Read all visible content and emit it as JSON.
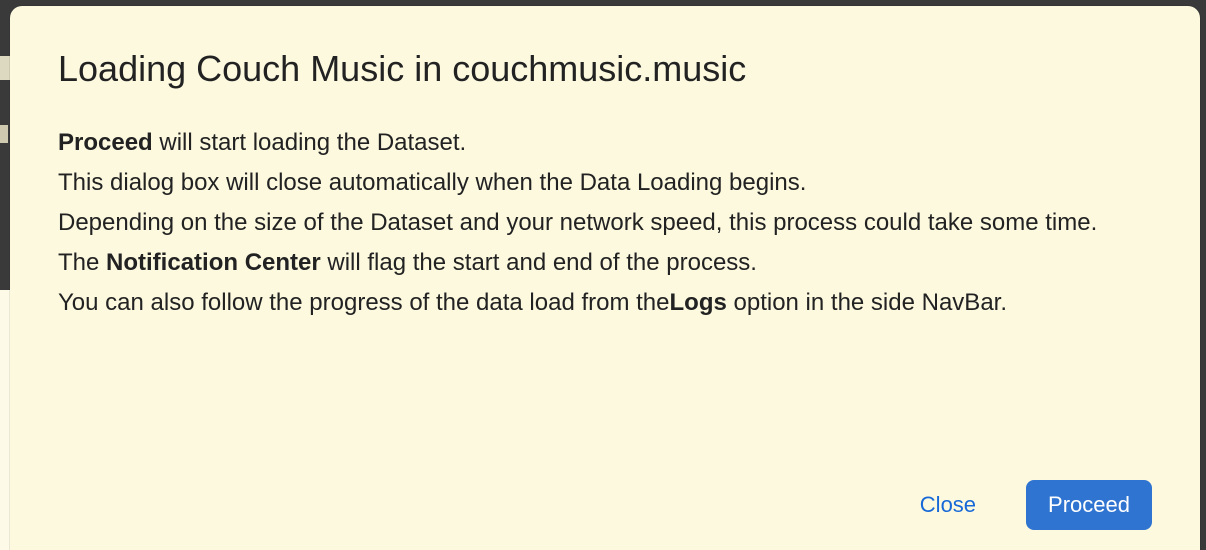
{
  "modal": {
    "title": "Loading Couch Music in couchmusic.music",
    "body": {
      "line1_strong": "Proceed",
      "line1_rest": " will start loading the Dataset.",
      "line2": "This dialog box will close automatically when the Data Loading begins.",
      "line3": "Depending on the size of the Dataset and your network speed, this process could take some time.",
      "line4_pre": "The ",
      "line4_strong": "Notification Center",
      "line4_post": " will flag the start and end of the process.",
      "line5_pre": "You can also follow the progress of the data load from the",
      "line5_strong": "Logs",
      "line5_post": " option in the side NavBar."
    },
    "buttons": {
      "close": "Close",
      "proceed": "Proceed"
    }
  }
}
